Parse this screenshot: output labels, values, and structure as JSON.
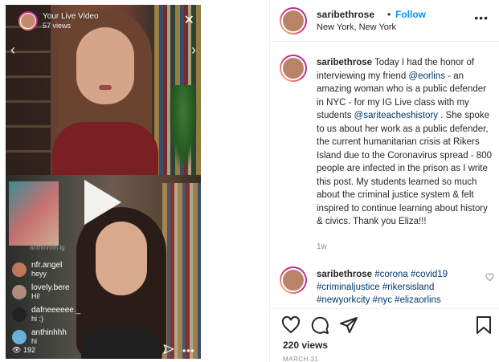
{
  "live": {
    "title": "Your Live Video",
    "subtitle": "57 views",
    "viewer_count": "192",
    "faded_user": "anthinnnh ig",
    "comments": [
      {
        "name": "nfr.angel",
        "text": "heyy",
        "color": "#c0765a"
      },
      {
        "name": "lovely.bere",
        "text": "Hi!",
        "color": "#b08c7a"
      },
      {
        "name": "dafneeeeee._",
        "text": "hi :)",
        "color": "#222222"
      },
      {
        "name": "anthinhhh",
        "text": "hi",
        "color": "#6bb0d8"
      }
    ]
  },
  "post": {
    "username": "saribethrose",
    "separator": "•",
    "follow_label": "Follow",
    "location": "New York, New York",
    "caption_user": "saribethrose",
    "caption_parts": {
      "p1": " Today I had the honor of interviewing my friend ",
      "mention1": "@eorlins",
      "p2": " - an amazing woman who is a public defender in NYC - for my IG Live class with my students ",
      "mention2": "@sariteacheshistory",
      "p3": " . She spoke to us about her work as a public defender, the current humanitarian crisis at Rikers Island due to the Coronavirus spread - 800 people are infected in the prison as I write this post. My students learned so much about the criminal justice system & felt inspired to continue learning about history & civics. Thank you Eliza!!!"
    },
    "time_ago": "1w",
    "comment_user": "saribethrose",
    "hashtags": [
      "#corona",
      "#covid19",
      "#criminaljustice",
      "#rikersisland",
      "#newyorkcity",
      "#nyc",
      "#elizaorlins"
    ],
    "views": "220 views",
    "date": "MARCH 31"
  }
}
